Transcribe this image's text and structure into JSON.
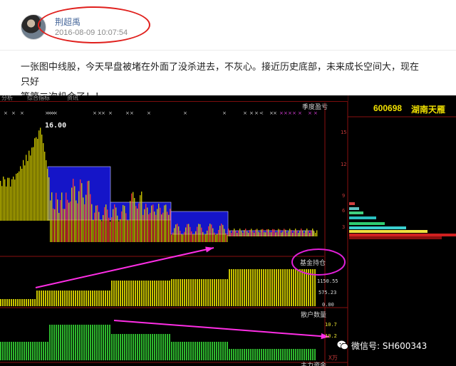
{
  "post": {
    "username": "荆超禹",
    "timestamp": "2016-08-09 10:07:54",
    "body_line1": "一张图中线股，今天早盘被堵在外面了没杀进去，不灰心。接近历史底部，未来成长空间大，现在只好",
    "body_line2": "等第二次机会了！！"
  },
  "chart": {
    "tabs": [
      "分析",
      "综合指标",
      "资讯"
    ],
    "stock_code": "600698",
    "stock_name": "湖南天雁",
    "peak_price_label": "16.00",
    "labels": {
      "top_right": "季度盈亏",
      "fund_panel": "基金持仓",
      "holders_panel": "散户数量",
      "bottom_panel": "主力资金"
    },
    "price_axis": [
      "15",
      "12",
      "9",
      "6",
      "3"
    ],
    "fund_axis": [
      "1150.55",
      "575.23",
      "0.00"
    ],
    "holders_axis": [
      "10.7",
      "10.2"
    ],
    "holders_unit": "X万",
    "colors": {
      "price_up": "#ff3b3b",
      "price_bar": "#d8d000",
      "cost_block": "#1515c8",
      "fund_bar": "#c9c400",
      "holders_bar": "#2db82d",
      "arrow": "#ff2ee6",
      "annotation_ring": "#e21fd8"
    }
  },
  "watermark": {
    "text": "微信号: SH600343",
    "icon": "wechat-icon"
  }
}
